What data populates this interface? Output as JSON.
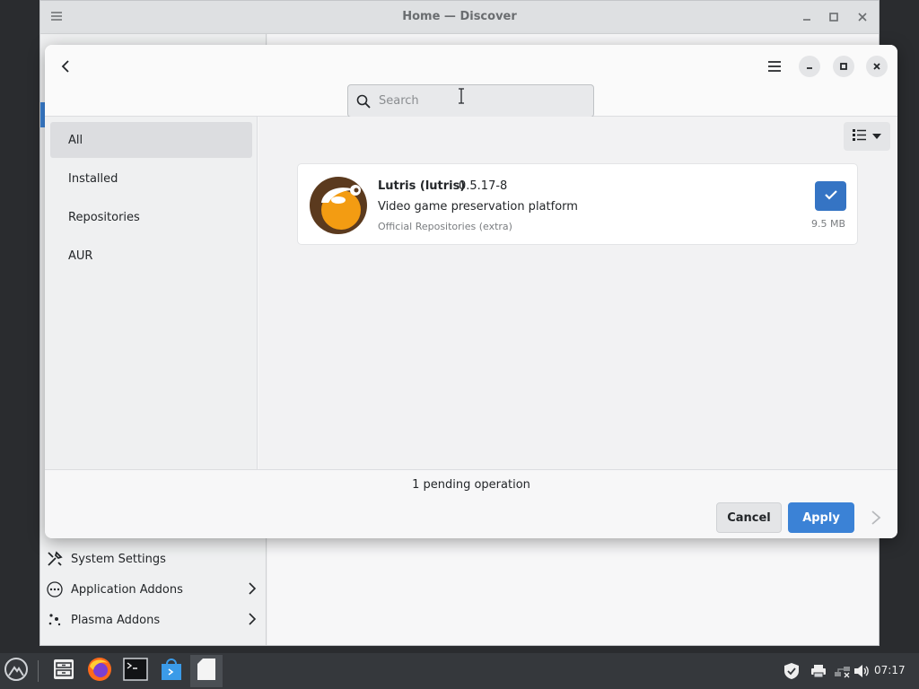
{
  "window": {
    "title": "Home — Discover"
  },
  "background_sidebar": {
    "items": [
      {
        "label": "System Settings",
        "icon": "tools-icon"
      },
      {
        "label": "Application Addons",
        "icon": "dots-circle-icon"
      },
      {
        "label": "Plasma Addons",
        "icon": "sparkle-icon"
      }
    ]
  },
  "dialog": {
    "search": {
      "placeholder": "Search",
      "value": ""
    },
    "sidebar": {
      "items": [
        {
          "label": "All",
          "selected": true
        },
        {
          "label": "Installed",
          "selected": false
        },
        {
          "label": "Repositories",
          "selected": false
        },
        {
          "label": "AUR",
          "selected": false
        }
      ]
    },
    "app": {
      "name": "Lutris (lutris)",
      "version": "0.5.17-8",
      "description": "Video game preservation platform",
      "source": "Official Repositories (extra)",
      "size": "9.5 MB",
      "checked": true
    },
    "footer": {
      "pending": "1 pending operation",
      "cancel_label": "Cancel",
      "apply_label": "Apply"
    }
  },
  "taskbar": {
    "clock": "07:17",
    "apps": [
      "app-launcher-icon",
      "file-manager-icon",
      "firefox-icon",
      "terminal-icon",
      "discover-store-icon",
      "document-icon"
    ]
  },
  "colors": {
    "accent": "#3b82d6",
    "check_button": "#3574c4",
    "taskbar": "#35383c",
    "lutris_orange": "#f39c12",
    "lutris_brown": "#5b3a1e"
  }
}
